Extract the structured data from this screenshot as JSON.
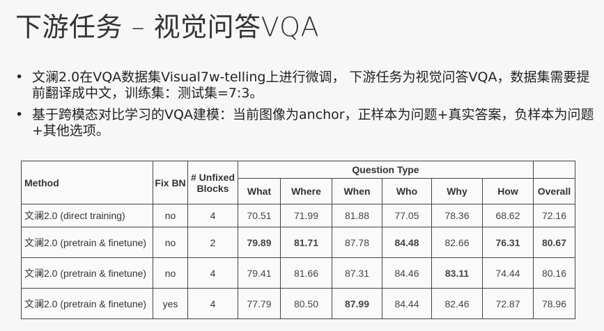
{
  "slide": {
    "title": "下游任务 – 视觉问答VQA",
    "bullets": [
      "文澜2.0在VQA数据集Visual7w-telling上进行微调， 下游任务为视觉问答VQA，数据集需要提前翻译成中文，训练集：测试集=7:3。",
      "基于跨模态对比学习的VQA建模：当前图像为anchor，正样本为问题+真实答案，负样本为问题+其他选项。"
    ]
  },
  "table": {
    "headers": {
      "method": "Method",
      "fix_bn": "Fix BN",
      "unfixed_blocks": "# Unfixed Blocks",
      "question_type": "Question Type",
      "what": "What",
      "where": "Where",
      "when": "When",
      "who": "Who",
      "why": "Why",
      "how": "How",
      "overall": "Overall"
    },
    "rows": [
      {
        "method": "文澜2.0 (direct training)",
        "fix_bn": "no",
        "blocks": "4",
        "what": "70.51",
        "where": "71.99",
        "when": "81.88",
        "who": "77.05",
        "why": "78.36",
        "how": "68.62",
        "overall": "72.16"
      },
      {
        "method": "文澜2.0 (pretrain & finetune)",
        "fix_bn": "no",
        "blocks": "2",
        "what": "79.89",
        "where": "81.71",
        "when": "87.78",
        "who": "84.48",
        "why": "82.66",
        "how": "76.31",
        "overall": "80.67"
      },
      {
        "method": "文澜2.0 (pretrain & finetune)",
        "fix_bn": "no",
        "blocks": "4",
        "what": "79.41",
        "where": "81.66",
        "when": "87.31",
        "who": "84.46",
        "why": "83.11",
        "how": "74.44",
        "overall": "80.16"
      },
      {
        "method": "文澜2.0 (pretrain & finetune)",
        "fix_bn": "yes",
        "blocks": "4",
        "what": "77.79",
        "where": "80.50",
        "when": "87.99",
        "who": "84.44",
        "why": "82.46",
        "how": "72.87",
        "overall": "78.96"
      }
    ]
  }
}
